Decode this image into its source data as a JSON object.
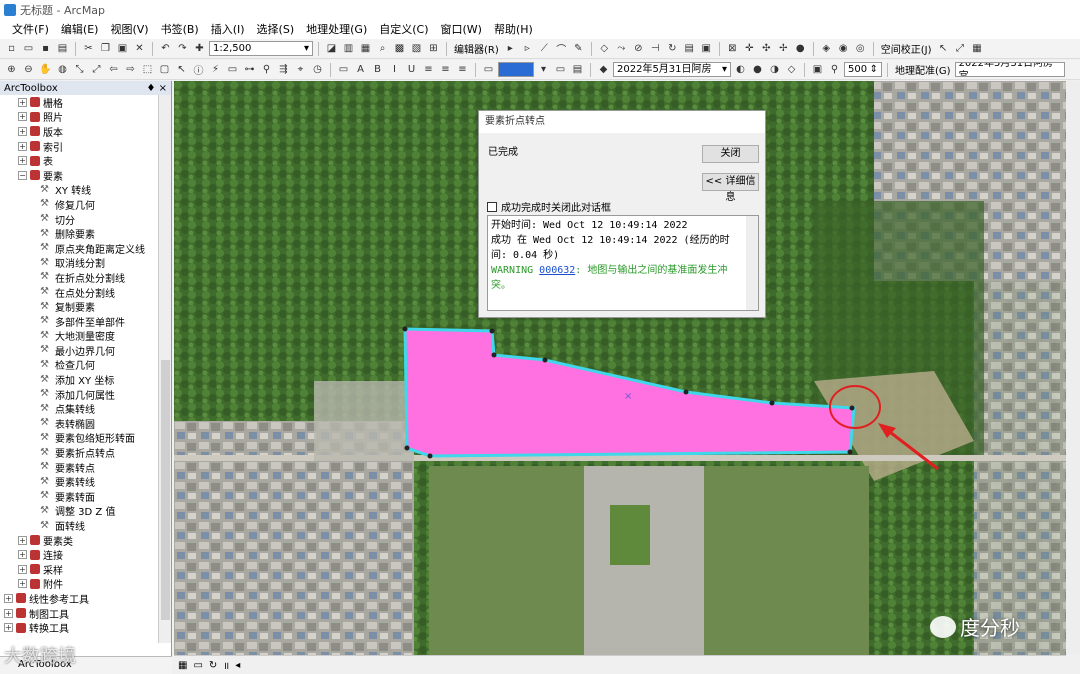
{
  "window": {
    "title": "无标题 - ArcMap"
  },
  "menu": [
    "文件(F)",
    "编辑(E)",
    "视图(V)",
    "书签(B)",
    "插入(I)",
    "选择(S)",
    "地理处理(G)",
    "自定义(C)",
    "窗口(W)",
    "帮助(H)"
  ],
  "toolbar1": {
    "scale": "1:2,500",
    "editor_label": "编辑器(R)",
    "spatial_adjust_label": "空间校正(J)"
  },
  "toolbar2": {
    "layer_combo": "2022年5月31日阿房",
    "zoom_value": "500",
    "georef_label": "地理配准(G)",
    "georef_layer": "2022年5月31日阿房宫"
  },
  "toolbox": {
    "title": "ArcToolbox",
    "pin": "♦ ×",
    "items": [
      {
        "label": "栅格",
        "kind": "toolset",
        "level": 1
      },
      {
        "label": "照片",
        "kind": "toolset",
        "level": 1
      },
      {
        "label": "版本",
        "kind": "toolset",
        "level": 1
      },
      {
        "label": "索引",
        "kind": "toolset",
        "level": 1
      },
      {
        "label": "表",
        "kind": "toolset",
        "level": 1
      },
      {
        "label": "要素",
        "kind": "toolset-open",
        "level": 1
      },
      {
        "label": "XY 转线",
        "kind": "tool",
        "level": 2
      },
      {
        "label": "修复几何",
        "kind": "tool",
        "level": 2
      },
      {
        "label": "切分",
        "kind": "tool",
        "level": 2
      },
      {
        "label": "删除要素",
        "kind": "tool",
        "level": 2
      },
      {
        "label": "原点夹角距离定义线",
        "kind": "tool",
        "level": 2
      },
      {
        "label": "取消线分割",
        "kind": "tool",
        "level": 2
      },
      {
        "label": "在折点处分割线",
        "kind": "tool",
        "level": 2
      },
      {
        "label": "在点处分割线",
        "kind": "tool",
        "level": 2
      },
      {
        "label": "复制要素",
        "kind": "tool",
        "level": 2
      },
      {
        "label": "多部件至单部件",
        "kind": "tool",
        "level": 2
      },
      {
        "label": "大地测量密度",
        "kind": "tool",
        "level": 2
      },
      {
        "label": "最小边界几何",
        "kind": "tool",
        "level": 2
      },
      {
        "label": "检查几何",
        "kind": "tool",
        "level": 2
      },
      {
        "label": "添加 XY 坐标",
        "kind": "tool",
        "level": 2
      },
      {
        "label": "添加几何属性",
        "kind": "tool",
        "level": 2
      },
      {
        "label": "点集转线",
        "kind": "tool",
        "level": 2
      },
      {
        "label": "表转椭圆",
        "kind": "tool",
        "level": 2
      },
      {
        "label": "要素包络矩形转面",
        "kind": "tool",
        "level": 2
      },
      {
        "label": "要素折点转点",
        "kind": "tool",
        "level": 2
      },
      {
        "label": "要素转点",
        "kind": "tool",
        "level": 2
      },
      {
        "label": "要素转线",
        "kind": "tool",
        "level": 2
      },
      {
        "label": "要素转面",
        "kind": "tool",
        "level": 2
      },
      {
        "label": "调整 3D Z 值",
        "kind": "tool",
        "level": 2
      },
      {
        "label": "面转线",
        "kind": "tool",
        "level": 2
      },
      {
        "label": "要素类",
        "kind": "toolset",
        "level": 1
      },
      {
        "label": "连接",
        "kind": "toolset",
        "level": 1
      },
      {
        "label": "采样",
        "kind": "toolset",
        "level": 1
      },
      {
        "label": "附件",
        "kind": "toolset",
        "level": 1
      },
      {
        "label": "线性参考工具",
        "kind": "toolbox",
        "level": 0
      },
      {
        "label": "制图工具",
        "kind": "toolbox",
        "level": 0
      },
      {
        "label": "转换工具",
        "kind": "toolbox",
        "level": 0
      }
    ],
    "tab_label": "ArcToolbox"
  },
  "dialog": {
    "title": "要素折点转点",
    "status": "已完成",
    "close_button": "关闭",
    "details_button": "<< 详细信息",
    "checkbox_label": "成功完成时关闭此对话框",
    "log": {
      "start": "开始时间: Wed Oct 12 10:49:14 2022",
      "success": "成功 在 Wed Oct 12 10:49:14 2022 (经历的时间: 0.04 秒)",
      "warning_prefix": "WARNING ",
      "warning_code": "000632",
      "warning_text": ": 地图与输出之间的基准面发生冲突。"
    }
  },
  "watermarks": {
    "left": "大数跨境",
    "right": "度分秒"
  },
  "colors": {
    "polygon_fill": "#ff70e0",
    "polygon_outline": "#3fd7ea",
    "highlight_circle": "#e02020"
  }
}
